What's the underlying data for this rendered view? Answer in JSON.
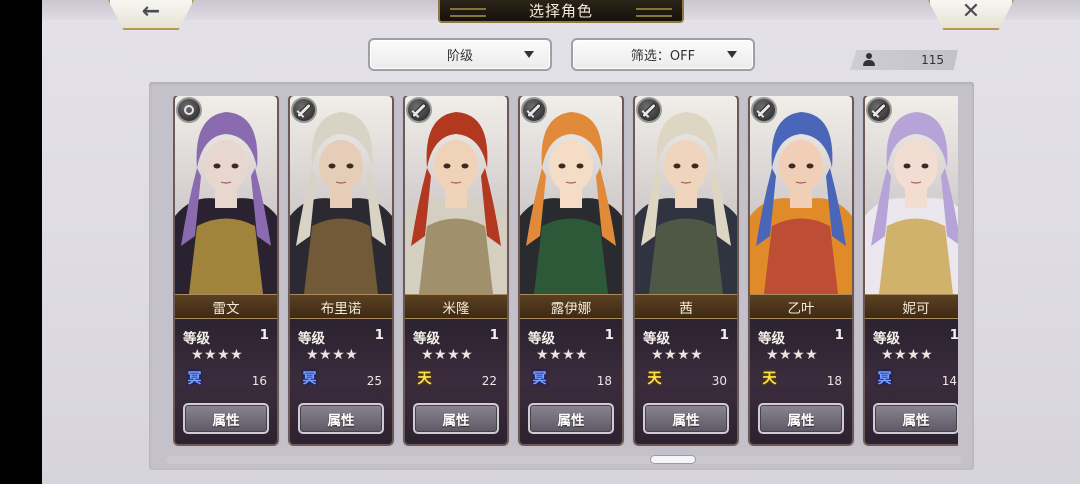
{
  "header": {
    "title": "选择角色",
    "back_icon_glyph": "←",
    "close_icon_glyph": "✕"
  },
  "filters": {
    "rank_label": "阶级",
    "filter_label": "筛选：OFF"
  },
  "roster_count": "115",
  "card_common": {
    "level_label": "等级",
    "attribute_button": "属性"
  },
  "characters": [
    {
      "name": "雷文",
      "level": "1",
      "stars": "★★★★",
      "element": "冥",
      "element_type": "dark",
      "cost": "16",
      "weapon": "spiral",
      "palette": [
        "#8a6bb0",
        "#2a2230",
        "#c9a640",
        "#e8d7cf"
      ]
    },
    {
      "name": "布里诺",
      "level": "1",
      "stars": "★★★★",
      "element": "冥",
      "element_type": "dark",
      "cost": "25",
      "weapon": "sword",
      "palette": [
        "#d9d3c6",
        "#2b2a33",
        "#8b6a3a",
        "#e6cdb8"
      ]
    },
    {
      "name": "米隆",
      "level": "1",
      "stars": "★★★★",
      "element": "天",
      "element_type": "light",
      "cost": "22",
      "weapon": "sword",
      "palette": [
        "#b2381f",
        "#d5cfc2",
        "#8d7b4e",
        "#f0d2b8"
      ]
    },
    {
      "name": "露伊娜",
      "level": "1",
      "stars": "★★★★",
      "element": "冥",
      "element_type": "dark",
      "cost": "18",
      "weapon": "sword",
      "palette": [
        "#e08a3a",
        "#2a2b2e",
        "#2f6a3e",
        "#f5dcc6"
      ]
    },
    {
      "name": "茜",
      "level": "1",
      "stars": "★★★★",
      "element": "天",
      "element_type": "light",
      "cost": "30",
      "weapon": "sword",
      "palette": [
        "#ddd6c2",
        "#2f3440",
        "#586645",
        "#efd5bd"
      ]
    },
    {
      "name": "乙叶",
      "level": "1",
      "stars": "★★★★",
      "element": "天",
      "element_type": "light",
      "cost": "18",
      "weapon": "sword",
      "palette": [
        "#4a66b8",
        "#e08a2a",
        "#b23838",
        "#f1cfb6"
      ]
    },
    {
      "name": "妮可",
      "level": "1",
      "stars": "★★★★",
      "element": "冥",
      "element_type": "dark",
      "cost": "14",
      "weapon": "sword",
      "palette": [
        "#b6a3d8",
        "#ece7ee",
        "#c7a042",
        "#f3ddd2"
      ]
    }
  ]
}
